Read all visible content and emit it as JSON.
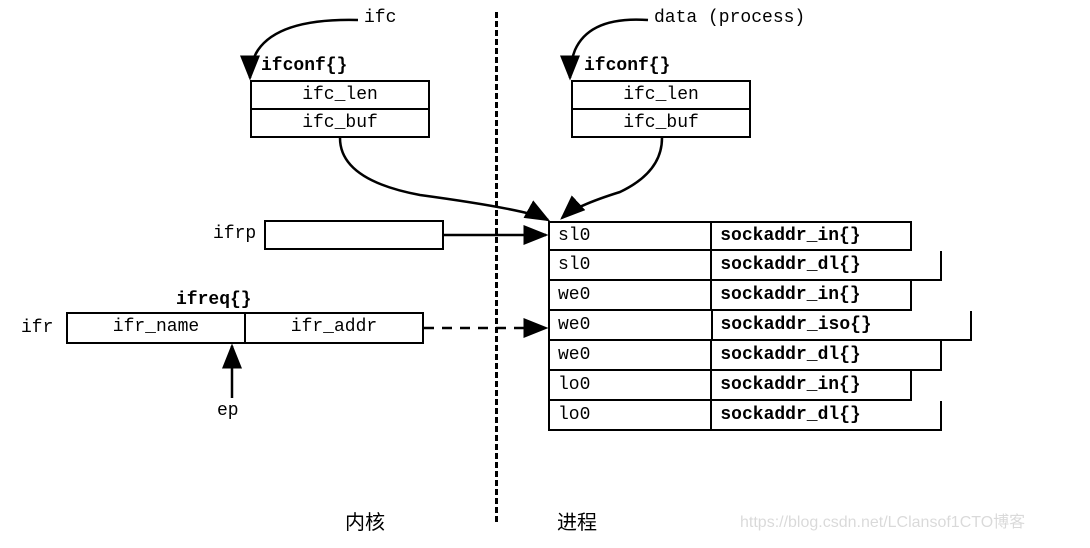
{
  "labels": {
    "ifc": "ifc",
    "data_process": "data (process)",
    "ifrp": "ifrp",
    "ifr": "ifr",
    "ep": "ep",
    "kernel": "内核",
    "process": "进程"
  },
  "structs": {
    "ifconf_left": {
      "title": "ifconf{}",
      "fields": [
        "ifc_len",
        "ifc_buf"
      ]
    },
    "ifconf_right": {
      "title": "ifconf{}",
      "fields": [
        "ifc_len",
        "ifc_buf"
      ]
    },
    "ifreq": {
      "title": "ifreq{}",
      "fields": [
        "ifr_name",
        "ifr_addr"
      ]
    }
  },
  "table": [
    {
      "name": "sl0",
      "type": "sockaddr_in{}",
      "extra": 0
    },
    {
      "name": "sl0",
      "type": "sockaddr_dl{}",
      "extra": 30
    },
    {
      "name": "we0",
      "type": "sockaddr_in{}",
      "extra": 0
    },
    {
      "name": "we0",
      "type": "sockaddr_iso{}",
      "extra": 60
    },
    {
      "name": "we0",
      "type": "sockaddr_dl{}",
      "extra": 30
    },
    {
      "name": "lo0",
      "type": "sockaddr_in{}",
      "extra": 0
    },
    {
      "name": "lo0",
      "type": "sockaddr_dl{}",
      "extra": 30
    }
  ],
  "watermark": "https://blog.csdn.net/LClansof1CTO博客"
}
